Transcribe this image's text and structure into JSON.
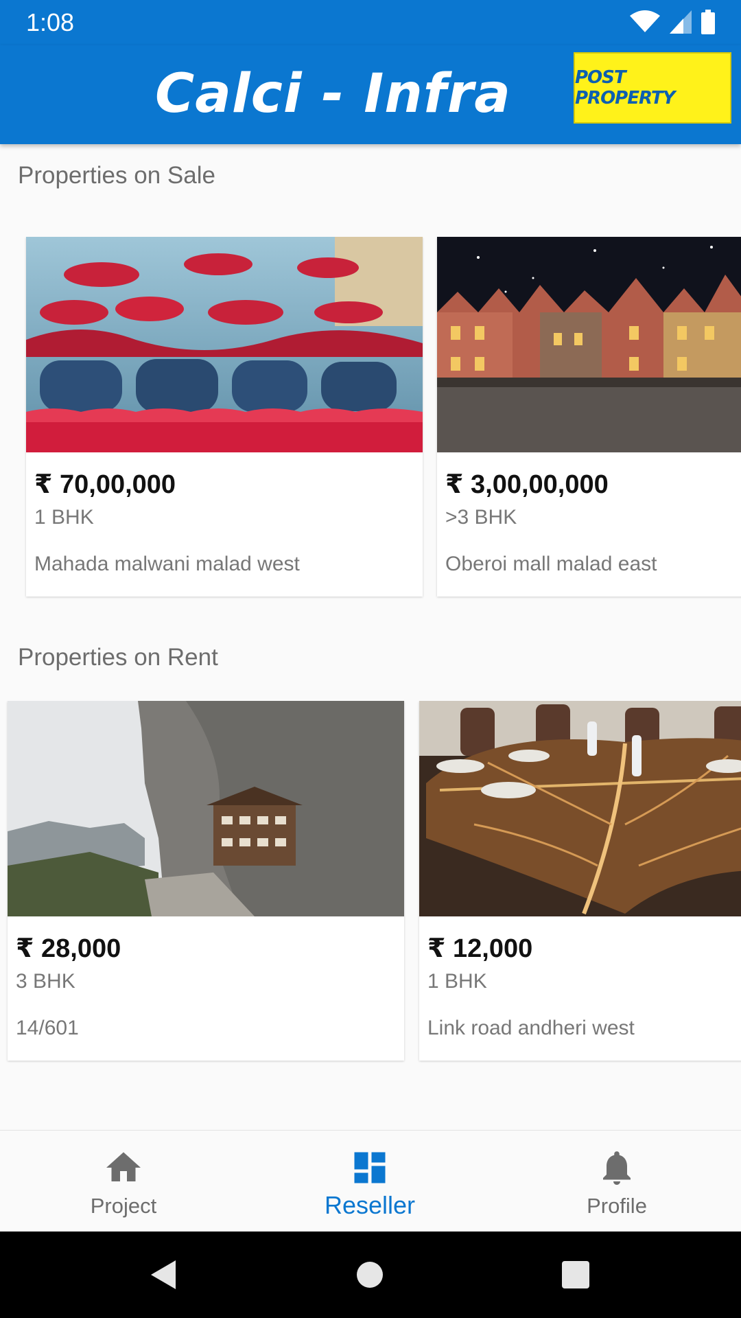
{
  "status_bar": {
    "time": "1:08"
  },
  "app_bar": {
    "title": "Calci - Infra",
    "post_button_label": "POST PROPERTY"
  },
  "sale": {
    "title": "Properties on Sale",
    "cards": [
      {
        "price": "₹ 70,00,000",
        "bhk": "1 BHK",
        "address": "Mahada malwani malad west"
      },
      {
        "price": "₹ 3,00,00,000",
        "bhk": ">3 BHK",
        "address": "Oberoi mall malad east"
      }
    ]
  },
  "rent": {
    "title": "Properties on Rent",
    "cards": [
      {
        "price": "₹ 28,000",
        "bhk": "3 BHK",
        "address": "14/601"
      },
      {
        "price": "₹ 12,000",
        "bhk": "1 BHK",
        "address": "Link road andheri west"
      }
    ]
  },
  "bottom_nav": {
    "items": [
      {
        "label": "Project",
        "icon": "home-icon"
      },
      {
        "label": "Reseller",
        "icon": "dashboard-icon"
      },
      {
        "label": "Profile",
        "icon": "bell-icon"
      }
    ],
    "active": "Reseller"
  },
  "colors": {
    "primary": "#0b77d0",
    "post_button_bg": "#fff21a",
    "nav_inactive": "#6d6d6d"
  }
}
